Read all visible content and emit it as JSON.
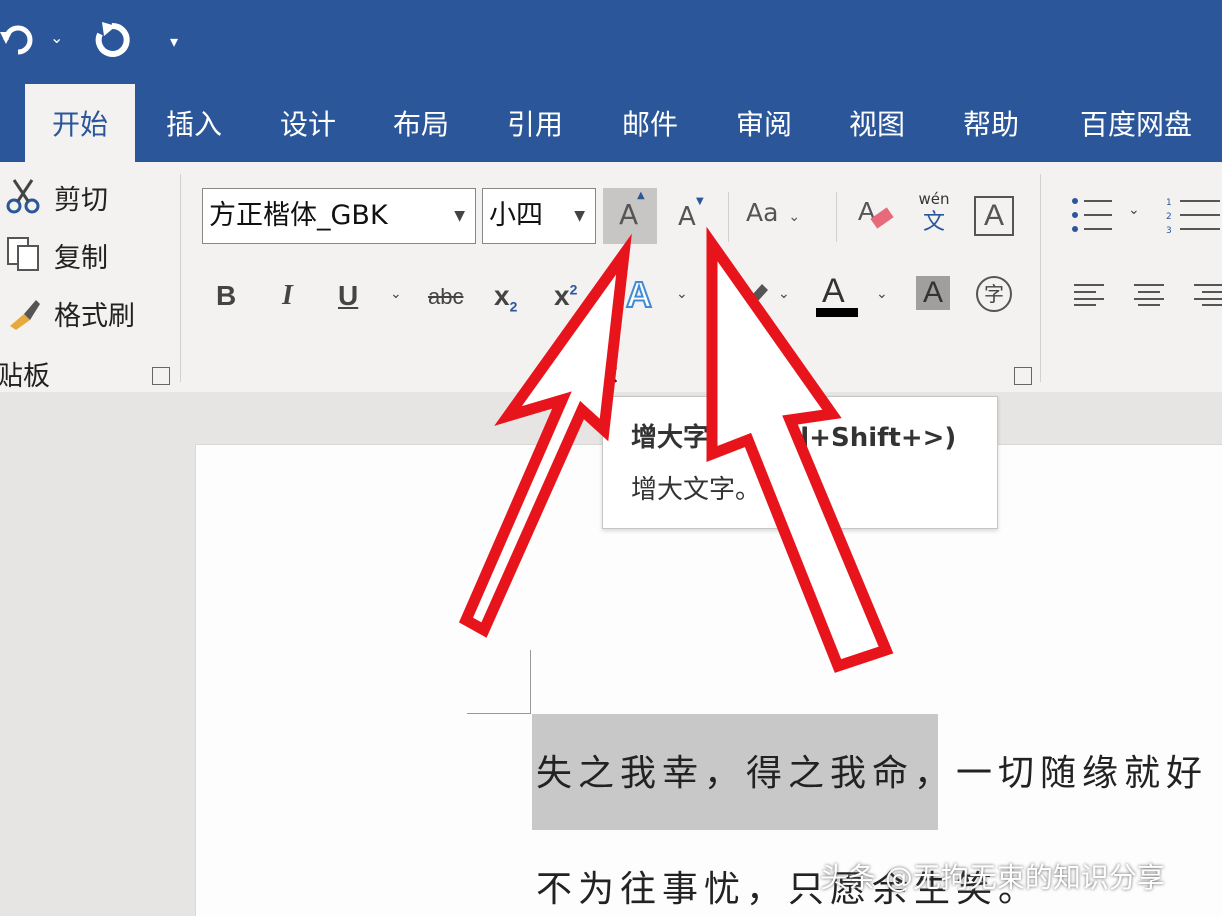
{
  "qat": {
    "undo_icon": "undo-icon",
    "redo_icon": "redo-icon",
    "customize_icon": "customize-icon"
  },
  "tabs": [
    {
      "label": "开始"
    },
    {
      "label": "插入"
    },
    {
      "label": "设计"
    },
    {
      "label": "布局"
    },
    {
      "label": "引用"
    },
    {
      "label": "邮件"
    },
    {
      "label": "审阅"
    },
    {
      "label": "视图"
    },
    {
      "label": "帮助"
    },
    {
      "label": "百度网盘"
    }
  ],
  "clipboard": {
    "cut": "剪切",
    "copy": "复制",
    "format_painter": "格式刷",
    "group_label": "贴板"
  },
  "font": {
    "font_name": "方正楷体_GBK",
    "font_size": "小四",
    "grow_glyph": "A",
    "shrink_glyph": "A",
    "change_case": "Aa",
    "phonetic_top": "wén",
    "phonetic_bottom": "文",
    "border_char": "A",
    "bold": "B",
    "italic": "I",
    "underline": "U",
    "strike": "abc",
    "subscript": "x",
    "subscript_mark": "2",
    "superscript": "x",
    "superscript_mark": "2",
    "text_effect": "A",
    "font_color": "A",
    "char_shading": "A",
    "enclose_char": "字",
    "group_label": "字体"
  },
  "tooltip": {
    "title": "增大字号 (Ctrl+Shift+>)",
    "description": "增大文字。"
  },
  "document": {
    "line1": "失之我幸，得之我命，一切随缘就好",
    "line2": "不为往事忧，只愿余生笑。"
  },
  "watermark": "头条 @无拘无束的知识分享",
  "colors": {
    "accent": "#2b579a",
    "arrow": "#e8141c",
    "highlight": "#c8c8c8"
  }
}
